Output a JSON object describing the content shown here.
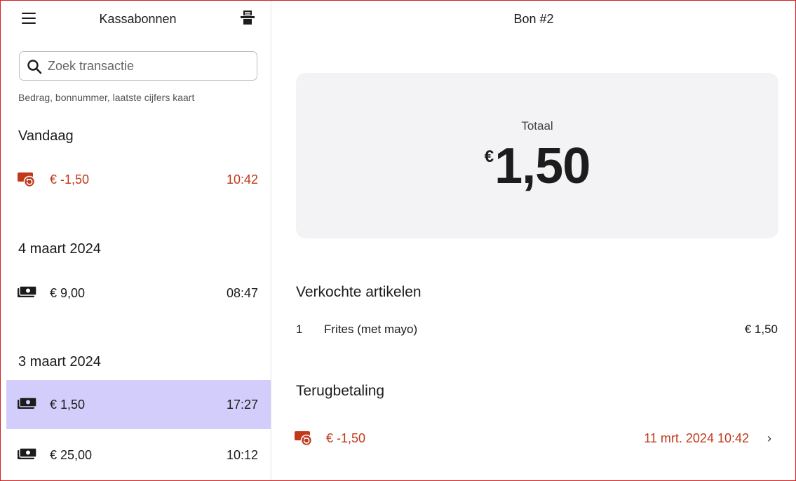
{
  "left_panel": {
    "title": "Kassabonnen",
    "search": {
      "placeholder": "Zoek transactie",
      "value": "",
      "hint": "Bedrag, bonnummer, laatste cijfers kaart"
    },
    "sections": [
      {
        "heading": "Vandaag",
        "rows": [
          {
            "amount": "€ -1,50",
            "time": "10:42",
            "type": "refund",
            "icon": "refund-icon"
          }
        ]
      },
      {
        "heading": "4 maart 2024",
        "rows": [
          {
            "amount": "€ 9,00",
            "time": "08:47",
            "type": "cash",
            "icon": "cash-icon"
          }
        ]
      },
      {
        "heading": "3 maart 2024",
        "rows": [
          {
            "amount": "€ 1,50",
            "time": "17:27",
            "type": "cash",
            "icon": "cash-icon",
            "selected": true
          },
          {
            "amount": "€ 25,00",
            "time": "10:12",
            "type": "cash",
            "icon": "cash-icon"
          }
        ]
      }
    ]
  },
  "detail": {
    "title": "Bon #2",
    "total_label": "Totaal",
    "total_currency": "€",
    "total_value": "1,50",
    "items_heading": "Verkochte artikelen",
    "items": [
      {
        "qty": "1",
        "name": "Frites  (met mayo)",
        "price": "€ 1,50"
      }
    ],
    "refund_heading": "Terugbetaling",
    "refund": {
      "amount": "€ -1,50",
      "datetime": "11 mrt. 2024 10:42",
      "icon": "refund-icon",
      "chevron": "›"
    }
  },
  "colors": {
    "refund": "#c0391b",
    "selected_row": "#d3cdfb",
    "card": "#f3f3f5",
    "frame": "#d51f1f"
  }
}
